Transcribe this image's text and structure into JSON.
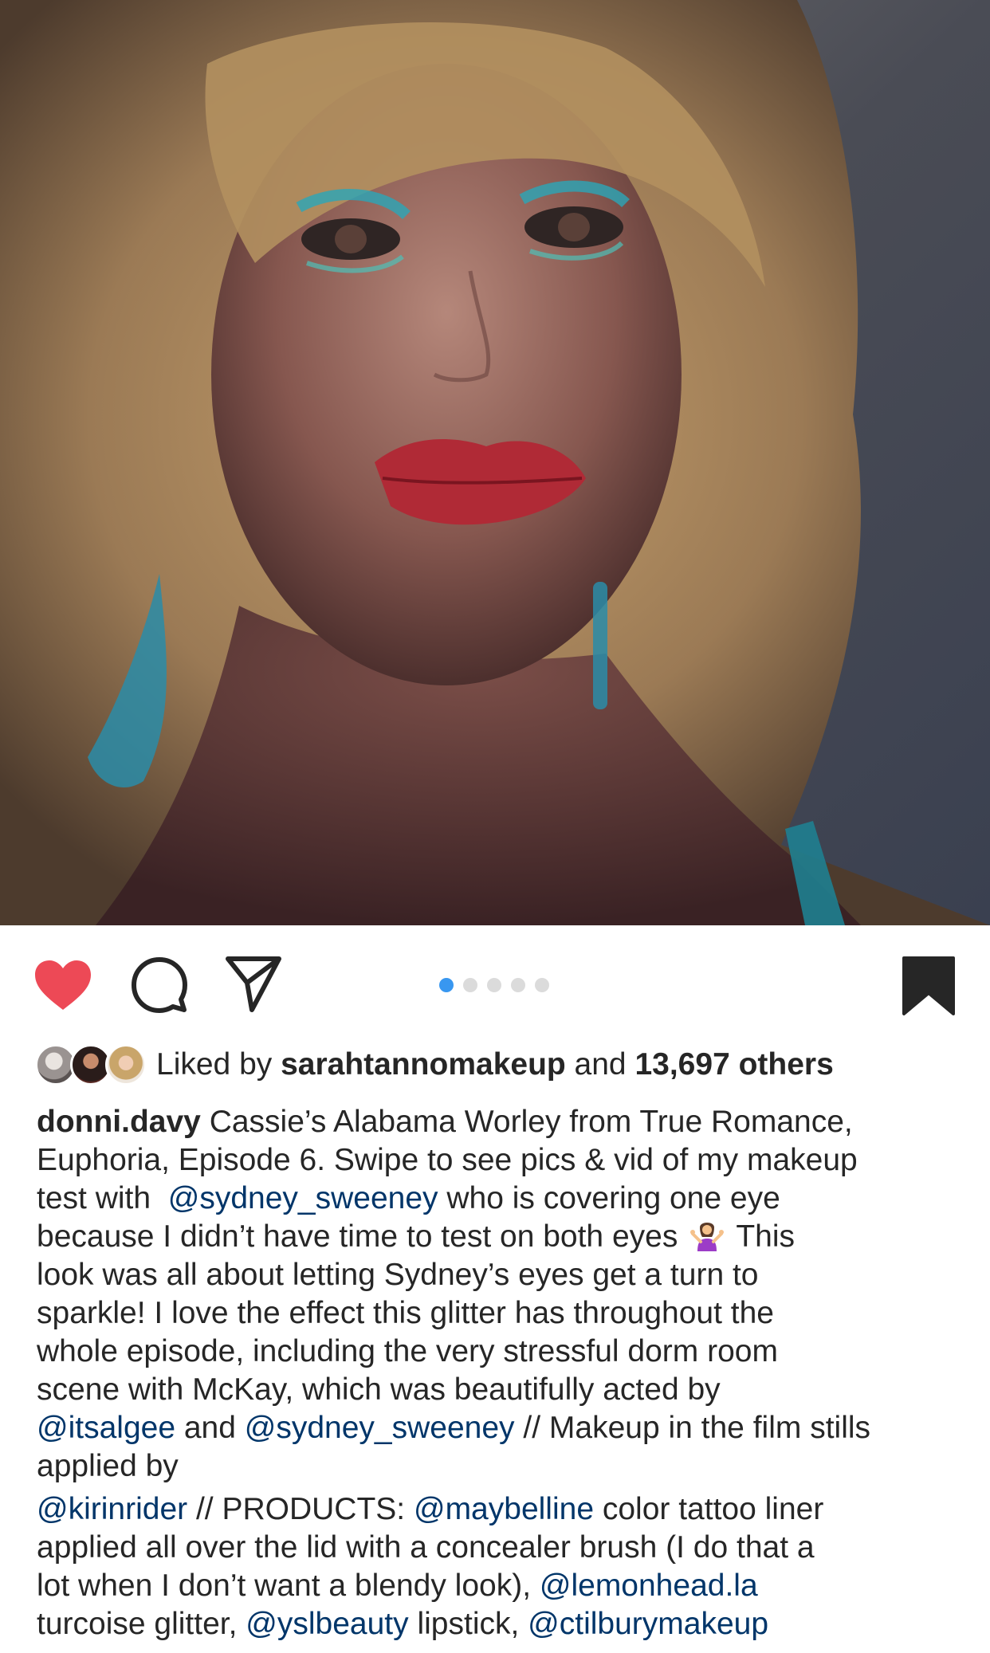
{
  "post": {
    "image_alt_subject": "portrait-photo",
    "carousel": {
      "count": 5,
      "active_index": 0
    },
    "actions": {
      "liked": true,
      "heart_color": "#ed4956"
    }
  },
  "likes": {
    "prefix": "Liked by ",
    "user": "sarahtannomakeup",
    "middle": " and ",
    "count": "13,697 others"
  },
  "caption": {
    "username": "donni.davy",
    "lines": [
      {
        "segments": [
          {
            "text": " Cassie’s Alabama Worley from True Romance,"
          }
        ]
      },
      {
        "segments": [
          {
            "text": "Euphoria, Episode 6. Swipe to see pics & vid of my makeup"
          }
        ]
      },
      {
        "segments": [
          {
            "text": "test with  "
          },
          {
            "text": "@sydney_sweeney",
            "mention": true
          },
          {
            "text": " who is covering one eye"
          }
        ]
      },
      {
        "segments": [
          {
            "text": "because I didn’t have time to test on both eyes "
          },
          {
            "emoji": "person-shrugging"
          },
          {
            "text": " This"
          }
        ]
      },
      {
        "segments": [
          {
            "text": "look was all about letting Sydney’s eyes get a turn to"
          }
        ]
      },
      {
        "segments": [
          {
            "text": "sparkle! I love the effect this glitter has throughout the"
          }
        ]
      },
      {
        "segments": [
          {
            "text": "whole episode, including the very stressful dorm room"
          }
        ]
      },
      {
        "segments": [
          {
            "text": "scene with McKay, which was beautifully acted by"
          }
        ]
      },
      {
        "segments": [
          {
            "text": "@itsalgee",
            "mention": true
          },
          {
            "text": " and "
          },
          {
            "text": "@sydney_sweeney",
            "mention": true
          },
          {
            "text": " // Makeup in the film stills"
          }
        ]
      },
      {
        "segments": [
          {
            "text": "applied by"
          }
        ]
      },
      {
        "gap": true
      },
      {
        "segments": [
          {
            "text": "@kirinrider",
            "mention": true
          },
          {
            "text": " // PRODUCTS: "
          },
          {
            "text": "@maybelline",
            "mention": true
          },
          {
            "text": " color tattoo liner"
          }
        ]
      },
      {
        "segments": [
          {
            "text": "applied all over the lid with a concealer brush (I do that a"
          }
        ]
      },
      {
        "segments": [
          {
            "text": "lot when I don’t want a blendy look), "
          },
          {
            "text": "@lemonhead.la",
            "mention": true
          }
        ]
      },
      {
        "segments": [
          {
            "text": "turcoise glitter, "
          },
          {
            "text": "@yslbeauty",
            "mention": true
          },
          {
            "text": " lipstick, "
          },
          {
            "text": "@ctilburymakeup",
            "mention": true
          }
        ]
      }
    ]
  },
  "colors": {
    "text": "#262626",
    "mention": "#003569",
    "dot_active": "#3897f0",
    "dot_inactive": "#dbdbdb"
  }
}
